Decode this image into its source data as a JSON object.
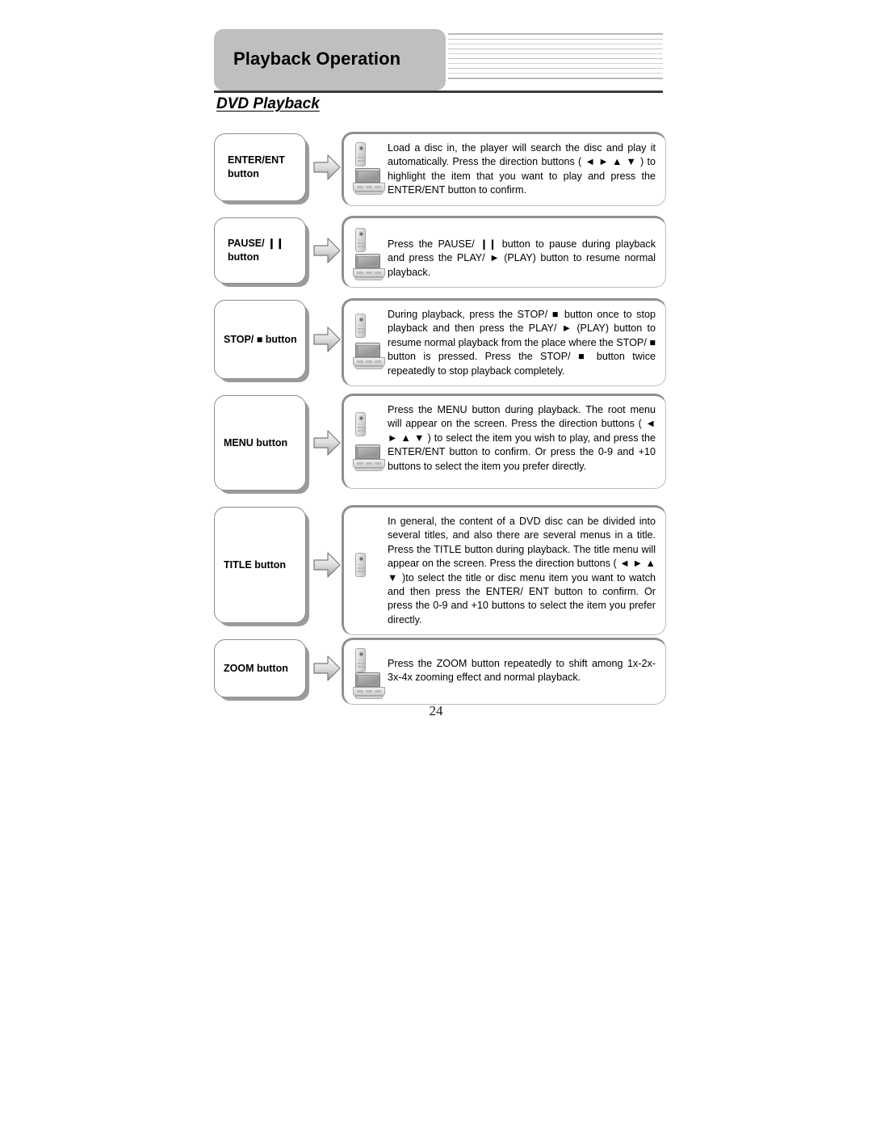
{
  "header": {
    "title": "Playback Operation",
    "decoration_line_count": 10
  },
  "section": {
    "heading": "DVD Playback"
  },
  "rows": [
    {
      "label": "ENTER/ENT\nbutton",
      "label_display": "ENTER/ENT button",
      "icons": [
        "remote-control-icon",
        "dvd-player-icon"
      ],
      "text": "Load a disc in, the player will search the disc and play it automatically. Press the direction buttons ( ◄ ► ▲ ▼ ) to highlight the item that you want to play and press the ENTER/ENT button to confirm."
    },
    {
      "label": "PAUSE/ ❙❙\nbutton",
      "label_display": "PAUSE/ ❙❙ button",
      "icons": [
        "remote-control-icon",
        "dvd-player-icon"
      ],
      "text": "Press the PAUSE/ ❙❙ button to pause during playback and press the PLAY/ ► (PLAY) button to resume normal playback."
    },
    {
      "label": "STOP/ ■ button",
      "label_display": "STOP/ ■ button",
      "icons": [
        "remote-control-icon",
        "dvd-player-icon"
      ],
      "text": "During playback, press the STOP/ ■ button once to stop playback and then press the PLAY/ ► (PLAY) button to resume normal playback from the place where the STOP/ ■ button is pressed. Press the STOP/ ■ button twice repeatedly to stop playback completely."
    },
    {
      "label": "MENU button",
      "label_display": "MENU button",
      "icons": [
        "remote-control-icon",
        "dvd-player-icon"
      ],
      "text": "Press the MENU button during playback. The root menu will appear on the screen. Press the direction buttons ( ◄ ► ▲ ▼ ) to select the item you wish to play, and press the ENTER/ENT button to confirm. Or press the 0-9 and +10 buttons to select the item you prefer directly."
    },
    {
      "label": "TITLE button",
      "label_display": "TITLE button",
      "icons": [
        "remote-control-icon"
      ],
      "text": "In general, the content of a DVD disc can be divided into several titles, and also there are several menus in a title. Press the TITLE button during playback. The title menu will appear on the screen. Press the direction buttons ( ◄ ► ▲ ▼ )to select the title or disc menu item you want to watch and then press the ENTER/ ENT button to confirm. Or press the 0-9 and +10 buttons to select the item you prefer directly."
    },
    {
      "label": "ZOOM button",
      "label_display": "ZOOM button",
      "icons": [
        "remote-control-icon",
        "dvd-player-icon"
      ],
      "text": "Press the ZOOM button repeatedly to shift among 1x-2x-3x-4x zooming effect and normal playback."
    }
  ],
  "footer": {
    "page_number": "24"
  },
  "colors": {
    "header_tab_bg": "#bfbfbf",
    "rule": "#3a3a3a",
    "box_border": "#8d8d8d",
    "box_shadow": "#9b9b9b",
    "content_border_heavy": "#8f8f8f",
    "content_border_light": "#bdbdbd",
    "arrow_fill_light": "#f3f3f3",
    "arrow_fill_dark": "#a9a9a9"
  }
}
